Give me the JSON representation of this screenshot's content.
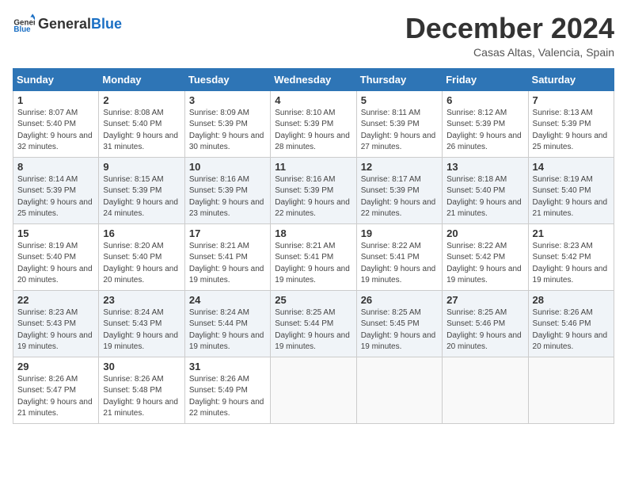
{
  "logo": {
    "text_general": "General",
    "text_blue": "Blue"
  },
  "title": {
    "month": "December 2024",
    "location": "Casas Altas, Valencia, Spain"
  },
  "weekdays": [
    "Sunday",
    "Monday",
    "Tuesday",
    "Wednesday",
    "Thursday",
    "Friday",
    "Saturday"
  ],
  "weeks": [
    [
      {
        "day": "1",
        "sunrise": "8:07 AM",
        "sunset": "5:40 PM",
        "daylight": "9 hours and 32 minutes."
      },
      {
        "day": "2",
        "sunrise": "8:08 AM",
        "sunset": "5:40 PM",
        "daylight": "9 hours and 31 minutes."
      },
      {
        "day": "3",
        "sunrise": "8:09 AM",
        "sunset": "5:39 PM",
        "daylight": "9 hours and 30 minutes."
      },
      {
        "day": "4",
        "sunrise": "8:10 AM",
        "sunset": "5:39 PM",
        "daylight": "9 hours and 28 minutes."
      },
      {
        "day": "5",
        "sunrise": "8:11 AM",
        "sunset": "5:39 PM",
        "daylight": "9 hours and 27 minutes."
      },
      {
        "day": "6",
        "sunrise": "8:12 AM",
        "sunset": "5:39 PM",
        "daylight": "9 hours and 26 minutes."
      },
      {
        "day": "7",
        "sunrise": "8:13 AM",
        "sunset": "5:39 PM",
        "daylight": "9 hours and 25 minutes."
      }
    ],
    [
      {
        "day": "8",
        "sunrise": "8:14 AM",
        "sunset": "5:39 PM",
        "daylight": "9 hours and 25 minutes."
      },
      {
        "day": "9",
        "sunrise": "8:15 AM",
        "sunset": "5:39 PM",
        "daylight": "9 hours and 24 minutes."
      },
      {
        "day": "10",
        "sunrise": "8:16 AM",
        "sunset": "5:39 PM",
        "daylight": "9 hours and 23 minutes."
      },
      {
        "day": "11",
        "sunrise": "8:16 AM",
        "sunset": "5:39 PM",
        "daylight": "9 hours and 22 minutes."
      },
      {
        "day": "12",
        "sunrise": "8:17 AM",
        "sunset": "5:39 PM",
        "daylight": "9 hours and 22 minutes."
      },
      {
        "day": "13",
        "sunrise": "8:18 AM",
        "sunset": "5:40 PM",
        "daylight": "9 hours and 21 minutes."
      },
      {
        "day": "14",
        "sunrise": "8:19 AM",
        "sunset": "5:40 PM",
        "daylight": "9 hours and 21 minutes."
      }
    ],
    [
      {
        "day": "15",
        "sunrise": "8:19 AM",
        "sunset": "5:40 PM",
        "daylight": "9 hours and 20 minutes."
      },
      {
        "day": "16",
        "sunrise": "8:20 AM",
        "sunset": "5:40 PM",
        "daylight": "9 hours and 20 minutes."
      },
      {
        "day": "17",
        "sunrise": "8:21 AM",
        "sunset": "5:41 PM",
        "daylight": "9 hours and 19 minutes."
      },
      {
        "day": "18",
        "sunrise": "8:21 AM",
        "sunset": "5:41 PM",
        "daylight": "9 hours and 19 minutes."
      },
      {
        "day": "19",
        "sunrise": "8:22 AM",
        "sunset": "5:41 PM",
        "daylight": "9 hours and 19 minutes."
      },
      {
        "day": "20",
        "sunrise": "8:22 AM",
        "sunset": "5:42 PM",
        "daylight": "9 hours and 19 minutes."
      },
      {
        "day": "21",
        "sunrise": "8:23 AM",
        "sunset": "5:42 PM",
        "daylight": "9 hours and 19 minutes."
      }
    ],
    [
      {
        "day": "22",
        "sunrise": "8:23 AM",
        "sunset": "5:43 PM",
        "daylight": "9 hours and 19 minutes."
      },
      {
        "day": "23",
        "sunrise": "8:24 AM",
        "sunset": "5:43 PM",
        "daylight": "9 hours and 19 minutes."
      },
      {
        "day": "24",
        "sunrise": "8:24 AM",
        "sunset": "5:44 PM",
        "daylight": "9 hours and 19 minutes."
      },
      {
        "day": "25",
        "sunrise": "8:25 AM",
        "sunset": "5:44 PM",
        "daylight": "9 hours and 19 minutes."
      },
      {
        "day": "26",
        "sunrise": "8:25 AM",
        "sunset": "5:45 PM",
        "daylight": "9 hours and 19 minutes."
      },
      {
        "day": "27",
        "sunrise": "8:25 AM",
        "sunset": "5:46 PM",
        "daylight": "9 hours and 20 minutes."
      },
      {
        "day": "28",
        "sunrise": "8:26 AM",
        "sunset": "5:46 PM",
        "daylight": "9 hours and 20 minutes."
      }
    ],
    [
      {
        "day": "29",
        "sunrise": "8:26 AM",
        "sunset": "5:47 PM",
        "daylight": "9 hours and 21 minutes."
      },
      {
        "day": "30",
        "sunrise": "8:26 AM",
        "sunset": "5:48 PM",
        "daylight": "9 hours and 21 minutes."
      },
      {
        "day": "31",
        "sunrise": "8:26 AM",
        "sunset": "5:49 PM",
        "daylight": "9 hours and 22 minutes."
      },
      null,
      null,
      null,
      null
    ]
  ],
  "labels": {
    "sunrise": "Sunrise:",
    "sunset": "Sunset:",
    "daylight": "Daylight:"
  }
}
